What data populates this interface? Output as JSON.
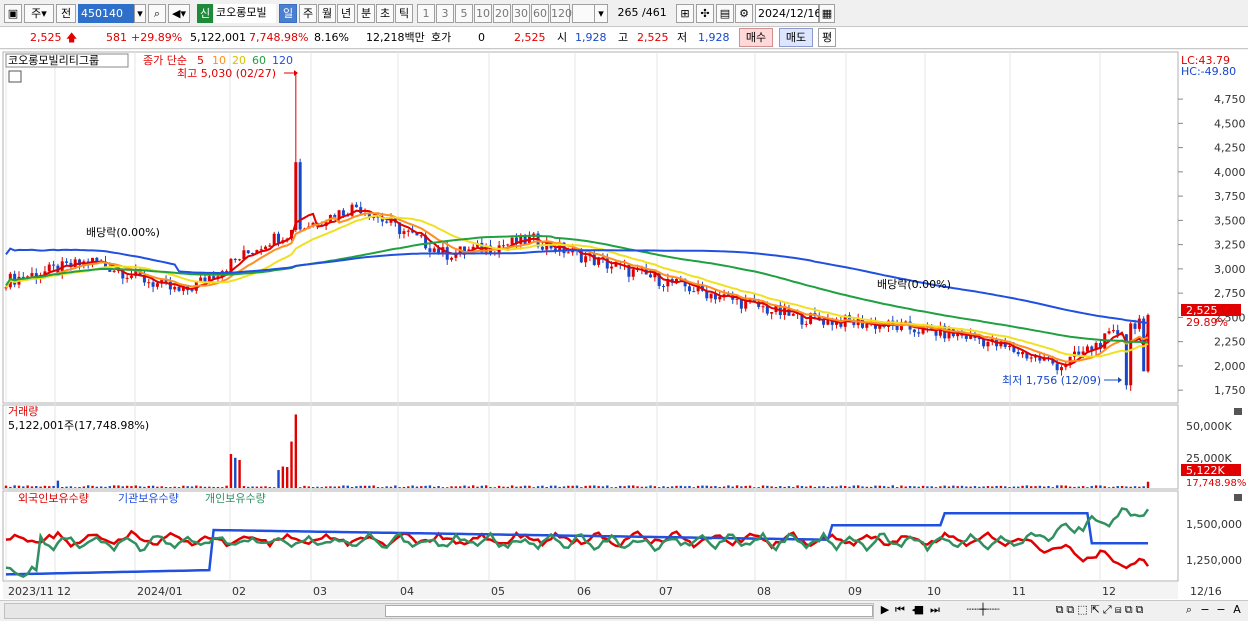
{
  "toolbar": {
    "type_label": "주",
    "prev_label": "전",
    "stock_code": "450140",
    "new_badge": "신",
    "stock_name": "코오롱모빌",
    "periods": [
      "일",
      "주",
      "월",
      "년",
      "분",
      "초",
      "틱"
    ],
    "active_period": "일",
    "intervals": [
      "1",
      "3",
      "5",
      "10",
      "20",
      "30",
      "60",
      "120"
    ],
    "count_current": "265",
    "count_total": "/461",
    "date": "2024/12/16"
  },
  "quote": {
    "price": "2,525",
    "change": "581",
    "change_pct": "+29.89%",
    "volume": "5,122,001",
    "volume_pct": "7,748.98%",
    "turnover_pct": "8.16%",
    "amount": "12,218백만",
    "hoga_label": "호가",
    "hoga_value": "0",
    "hoga_price": "2,525",
    "open_label": "시",
    "open": "1,928",
    "high_label": "고",
    "high": "2,525",
    "low_label": "저",
    "low": "1,928",
    "buy_label": "매수",
    "sell_label": "매도",
    "eq_label": "평"
  },
  "price_panel": {
    "name": "코오롱모빌리티그룹",
    "ma_label": "종가 단순",
    "ma_periods": [
      "5",
      "10",
      "20",
      "60",
      "120"
    ],
    "ma_colors": [
      "#e00000",
      "#ff9020",
      "#f0e020",
      "#20a040",
      "#2050e0"
    ],
    "high_annot": "최고 5,030 (02/27)",
    "low_annot": "최저 1,756 (12/09)",
    "div_annot_1": "배당락(0.00%)",
    "div_annot_2": "배당락(0.00%)",
    "lc": "LC:43.79",
    "hc": "HC:-49.80",
    "y_ticks": [
      "4,750",
      "4,500",
      "4,250",
      "4,000",
      "3,750",
      "3,500",
      "3,250",
      "3,000",
      "2,750",
      "2,500",
      "2,250",
      "2,000",
      "1,750"
    ],
    "price_tag": "2,525",
    "pct_tag": "29.89%"
  },
  "volume_panel": {
    "title": "거래량",
    "value": "5,122,001주(17,748.98%)",
    "y_ticks": [
      "50,000K",
      "25,000K"
    ],
    "tag": "5,122K",
    "tag2": "17,748.98%"
  },
  "holdings_panel": {
    "series": [
      "외국인보유수량",
      "기관보유수량",
      "개인보유수량"
    ],
    "series_colors": [
      "#e00000",
      "#2050e0",
      "#309060"
    ],
    "y_ticks": [
      "1,500,000",
      "1,250,000"
    ]
  },
  "x_axis": {
    "labels": [
      "2023/11",
      "12",
      "2024/01",
      "02",
      "03",
      "04",
      "05",
      "06",
      "07",
      "08",
      "09",
      "10",
      "11",
      "12"
    ],
    "end_label": "12/16"
  },
  "chart_data": {
    "type": "candlestick",
    "title": "코오롱모빌리티그룹",
    "ylim": [
      1700,
      5050
    ],
    "monthly_close": [
      {
        "x": "2023/11",
        "y": 2880
      },
      {
        "x": "2023/12",
        "y": 3080
      },
      {
        "x": "2024/01",
        "y": 2750
      },
      {
        "x": "2024/02",
        "y": 3300
      },
      {
        "x": "2024/03",
        "y": 3650
      },
      {
        "x": "2024/04",
        "y": 3150
      },
      {
        "x": "2024/05",
        "y": 3300
      },
      {
        "x": "2024/06",
        "y": 3000
      },
      {
        "x": "2024/07",
        "y": 2750
      },
      {
        "x": "2024/08",
        "y": 2500
      },
      {
        "x": "2024/09",
        "y": 2420
      },
      {
        "x": "2024/10",
        "y": 2300
      },
      {
        "x": "2024/11",
        "y": 2000
      },
      {
        "x": "2024/12",
        "y": 2525
      }
    ],
    "high": {
      "date": "02/27",
      "value": 5030
    },
    "low": {
      "date": "12/09",
      "value": 1756
    }
  }
}
